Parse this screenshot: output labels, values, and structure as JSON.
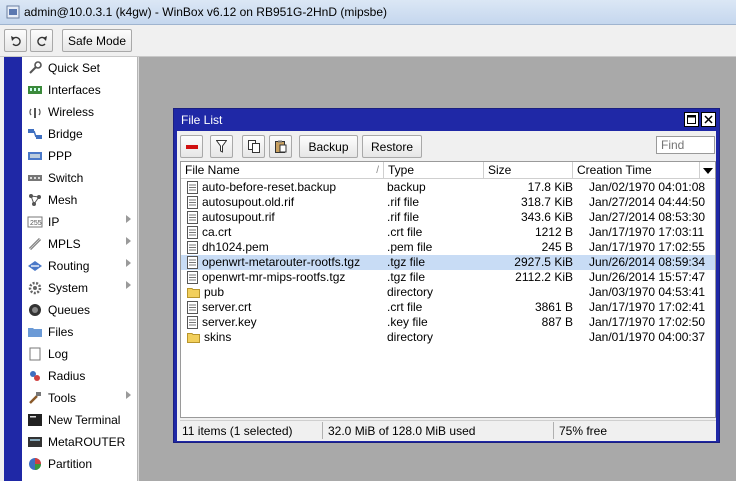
{
  "window": {
    "title": "admin@10.0.3.1 (k4gw) - WinBox v6.12 on RB951G-2HnD (mipsbe)"
  },
  "toolbar": {
    "safe_mode_label": "Safe Mode"
  },
  "sidebar": {
    "items": [
      {
        "label": "Quick Set",
        "icon": "quick-set-icon",
        "submenu": false
      },
      {
        "label": "Interfaces",
        "icon": "interfaces-icon",
        "submenu": false
      },
      {
        "label": "Wireless",
        "icon": "wireless-icon",
        "submenu": false
      },
      {
        "label": "Bridge",
        "icon": "bridge-icon",
        "submenu": false
      },
      {
        "label": "PPP",
        "icon": "ppp-icon",
        "submenu": false
      },
      {
        "label": "Switch",
        "icon": "switch-icon",
        "submenu": false
      },
      {
        "label": "Mesh",
        "icon": "mesh-icon",
        "submenu": false
      },
      {
        "label": "IP",
        "icon": "ip-icon",
        "submenu": true
      },
      {
        "label": "MPLS",
        "icon": "mpls-icon",
        "submenu": true
      },
      {
        "label": "Routing",
        "icon": "routing-icon",
        "submenu": true
      },
      {
        "label": "System",
        "icon": "system-gear-icon",
        "submenu": true
      },
      {
        "label": "Queues",
        "icon": "queues-icon",
        "submenu": false
      },
      {
        "label": "Files",
        "icon": "files-folder-icon",
        "submenu": false
      },
      {
        "label": "Log",
        "icon": "log-icon",
        "submenu": false
      },
      {
        "label": "Radius",
        "icon": "radius-icon",
        "submenu": false
      },
      {
        "label": "Tools",
        "icon": "tools-icon",
        "submenu": true
      },
      {
        "label": "New Terminal",
        "icon": "terminal-icon",
        "submenu": false
      },
      {
        "label": "MetaROUTER",
        "icon": "metarouter-icon",
        "submenu": false
      },
      {
        "label": "Partition",
        "icon": "partition-pie-icon",
        "submenu": false
      }
    ]
  },
  "file_list": {
    "title": "File List",
    "backup_label": "Backup",
    "restore_label": "Restore",
    "find_placeholder": "Find",
    "columns": [
      "File Name",
      "Type",
      "Size",
      "Creation Time"
    ],
    "rows": [
      {
        "name": "auto-before-reset.backup",
        "type": "backup",
        "size": "17.8 KiB",
        "time": "Jan/02/1970 04:01:08",
        "folder": false,
        "selected": false
      },
      {
        "name": "autosupout.old.rif",
        "type": ".rif file",
        "size": "318.7 KiB",
        "time": "Jan/27/2014 04:44:50",
        "folder": false,
        "selected": false
      },
      {
        "name": "autosupout.rif",
        "type": ".rif file",
        "size": "343.6 KiB",
        "time": "Jan/27/2014 08:53:30",
        "folder": false,
        "selected": false
      },
      {
        "name": "ca.crt",
        "type": ".crt file",
        "size": "1212 B",
        "time": "Jan/17/1970 17:03:11",
        "folder": false,
        "selected": false
      },
      {
        "name": "dh1024.pem",
        "type": ".pem file",
        "size": "245 B",
        "time": "Jan/17/1970 17:02:55",
        "folder": false,
        "selected": false
      },
      {
        "name": "openwrt-metarouter-rootfs.tgz",
        "type": ".tgz file",
        "size": "2927.5 KiB",
        "time": "Jun/26/2014 08:59:34",
        "folder": false,
        "selected": true
      },
      {
        "name": "openwrt-mr-mips-rootfs.tgz",
        "type": ".tgz file",
        "size": "2112.2 KiB",
        "time": "Jun/26/2014 15:57:47",
        "folder": false,
        "selected": false
      },
      {
        "name": "pub",
        "type": "directory",
        "size": "",
        "time": "Jan/03/1970 04:53:41",
        "folder": true,
        "selected": false
      },
      {
        "name": "server.crt",
        "type": ".crt file",
        "size": "3861 B",
        "time": "Jan/17/1970 17:02:41",
        "folder": false,
        "selected": false
      },
      {
        "name": "server.key",
        "type": ".key file",
        "size": "887 B",
        "time": "Jan/17/1970 17:02:50",
        "folder": false,
        "selected": false
      },
      {
        "name": "skins",
        "type": "directory",
        "size": "",
        "time": "Jan/01/1970 04:00:37",
        "folder": true,
        "selected": false
      }
    ],
    "status": {
      "items_text": "11 items (1 selected)",
      "usage_text": "32.0 MiB of 128.0 MiB used",
      "free_text": "75% free"
    }
  },
  "colors": {
    "sidebar_bar": "#1f28a6",
    "window_frame": "#1f28a6",
    "workspace": "#a9a9a9",
    "selection": "#c8dcf5"
  }
}
